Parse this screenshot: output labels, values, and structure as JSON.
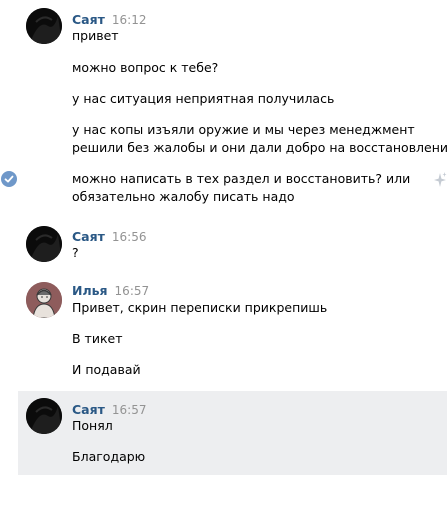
{
  "messages": [
    {
      "author": "Саят",
      "time": "16:12",
      "lines": [
        "привет",
        "можно вопрос к тебе?",
        "у нас ситуация неприятная получилась",
        "у нас копы изъяли оружие и мы через менеджмент",
        "решили без жалобы и они дали добро на восстановление",
        "можно написать в тех раздел и восстановить? или",
        "обязательно жалобу писать надо"
      ]
    },
    {
      "author": "Саят",
      "time": "16:56",
      "lines": [
        "?"
      ]
    },
    {
      "author": "Илья",
      "time": "16:57",
      "lines": [
        "Привет, скрин переписки прикрепишь",
        "В тикет",
        "И подавай"
      ]
    },
    {
      "author": "Саят",
      "time": "16:57",
      "lines": [
        "Понял",
        "Благодарю"
      ]
    }
  ],
  "colors": {
    "author": "#2a5885",
    "time": "#939393",
    "selected_bg": "#edeef0",
    "check": "#6f98c9"
  },
  "icons": [
    "dark-avatar",
    "sketch-avatar",
    "check-icon",
    "sparkle-icon"
  ]
}
